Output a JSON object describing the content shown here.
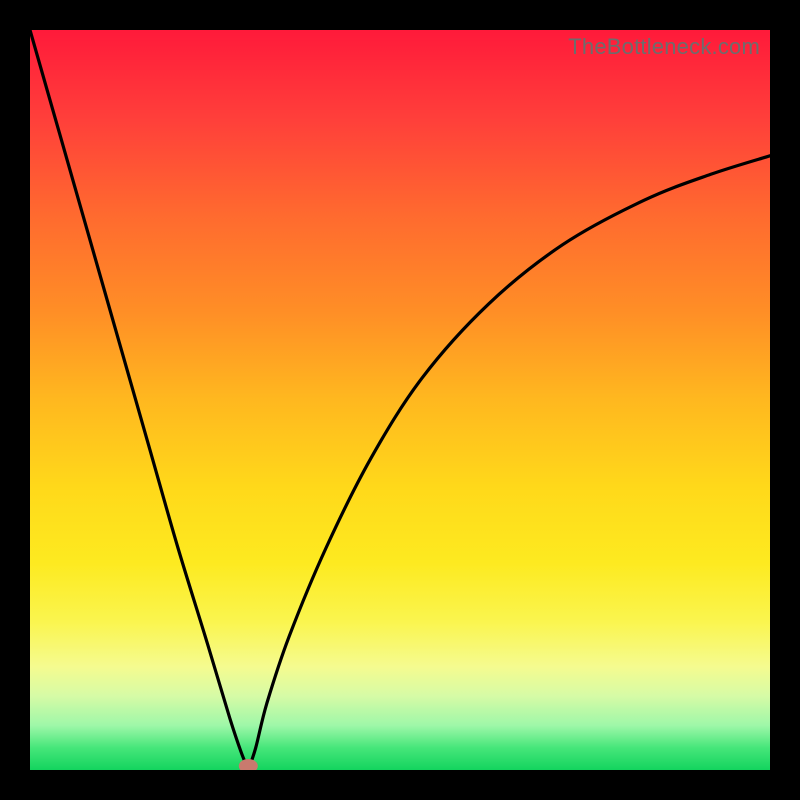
{
  "watermark": "TheBottleneck.com",
  "colors": {
    "frame": "#000000",
    "curve": "#000000",
    "marker_fill": "#c97a6e",
    "marker_stroke": "#c97a6e"
  },
  "chart_data": {
    "type": "line",
    "title": "",
    "xlabel": "",
    "ylabel": "",
    "xlim": [
      0,
      1
    ],
    "ylim": [
      0,
      1
    ],
    "annotations": [
      "TheBottleneck.com"
    ],
    "notes": "Bottleneck-style V curve over a red→yellow→green vertical gradient. No axis ticks or gridlines are shown; x/y are normalized 0–1. The minimum (optimal point) is marked with a small salmon dot.",
    "optimal_point": {
      "x": 0.295,
      "y": 0.0
    },
    "series": [
      {
        "name": "left-branch",
        "x": [
          0.0,
          0.04,
          0.08,
          0.12,
          0.16,
          0.2,
          0.24,
          0.27,
          0.285,
          0.295
        ],
        "values": [
          1.0,
          0.86,
          0.72,
          0.58,
          0.44,
          0.3,
          0.17,
          0.07,
          0.025,
          0.0
        ]
      },
      {
        "name": "right-branch",
        "x": [
          0.295,
          0.305,
          0.32,
          0.35,
          0.4,
          0.46,
          0.53,
          0.62,
          0.72,
          0.83,
          0.92,
          1.0
        ],
        "values": [
          0.0,
          0.03,
          0.09,
          0.18,
          0.3,
          0.42,
          0.53,
          0.63,
          0.71,
          0.77,
          0.805,
          0.83
        ]
      }
    ]
  }
}
